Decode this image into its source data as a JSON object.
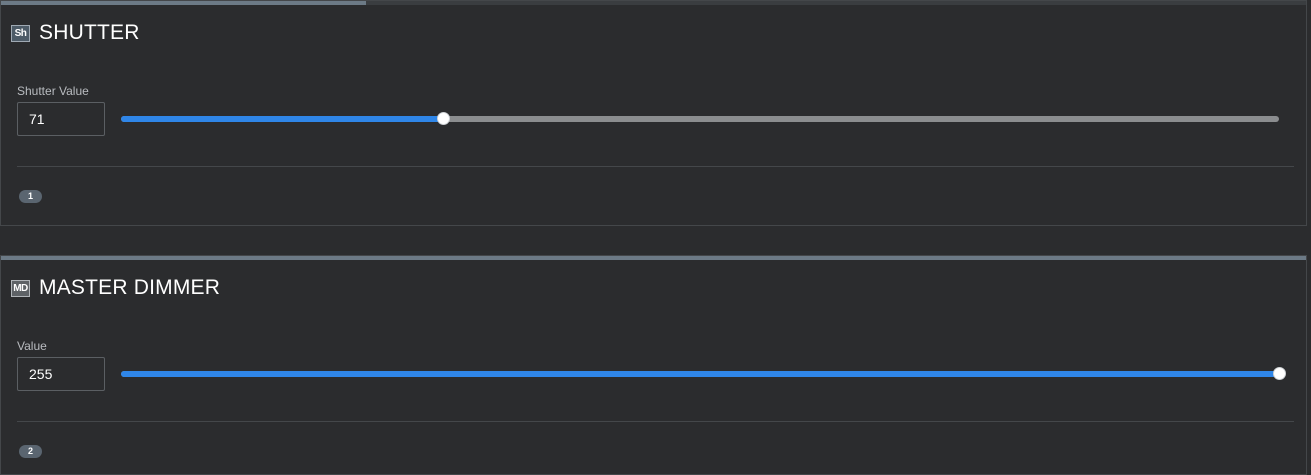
{
  "panels": [
    {
      "icon_label": "Sh",
      "icon_name": "shutter-icon",
      "title": "SHUTTER",
      "field_label": "Shutter Value",
      "value": "71",
      "slider_fraction": 0.2784,
      "progress_fraction": 0.28,
      "count": "1"
    },
    {
      "icon_label": "MD",
      "icon_name": "master-dimmer-icon",
      "title": "MASTER DIMMER",
      "field_label": "Value",
      "value": "255",
      "slider_fraction": 1.0,
      "progress_fraction": 1.0,
      "count": "2"
    }
  ],
  "colors": {
    "slider_fill": "#2f86e8",
    "slider_track": "#8b8d8f",
    "background": "#2b2c2e"
  }
}
